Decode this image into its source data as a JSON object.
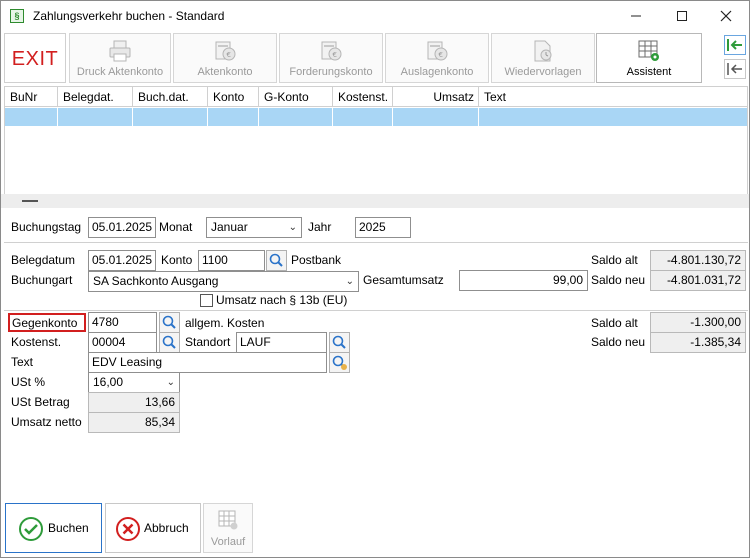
{
  "window": {
    "title": "Zahlungsverkehr buchen - Standard",
    "app_icon_glyph": "§",
    "controls": [
      "minimize",
      "maximize",
      "close"
    ]
  },
  "toolbar": {
    "exit_label": "EXIT",
    "buttons": [
      {
        "label": "Druck Aktenkonto",
        "icon": "printer-icon",
        "enabled": false
      },
      {
        "label": "Aktenkonto",
        "icon": "account-icon",
        "enabled": false
      },
      {
        "label": "Forderungskonto",
        "icon": "claim-account-icon",
        "enabled": false
      },
      {
        "label": "Auslagenkonto",
        "icon": "expense-account-icon",
        "enabled": false
      },
      {
        "label": "Wiedervorlagen",
        "icon": "resubmission-icon",
        "enabled": false
      },
      {
        "label": "Assistent",
        "icon": "grid-settings-icon",
        "enabled": true
      }
    ],
    "side_icons": [
      "arrow-left-in-icon",
      "arrow-left-out-icon"
    ]
  },
  "grid": {
    "columns": [
      "BuNr",
      "Belegdat.",
      "Buch.dat.",
      "Konto",
      "G-Konto",
      "Kostenst.",
      "Umsatz",
      "Text"
    ],
    "rows": [
      [
        "",
        "",
        "",
        "",
        "",
        "",
        "",
        ""
      ]
    ]
  },
  "header_form": {
    "buchungstag_label": "Buchungstag",
    "buchungstag_value": "05.01.2025",
    "monat_label": "Monat",
    "monat_value": "Januar",
    "jahr_label": "Jahr",
    "jahr_value": "2025"
  },
  "booking": {
    "belegdatum_label": "Belegdatum",
    "belegdatum_value": "05.01.2025",
    "konto_label": "Konto",
    "konto_value": "1100",
    "konto_name": "Postbank",
    "buchungsart_label": "Buchungart",
    "buchungsart_value": "SA Sachkonto Ausgang",
    "gesamtumsatz_label": "Gesamtumsatz",
    "gesamtumsatz_value": "99,00",
    "checkbox_label": "Umsatz nach § 13b (EU)",
    "checkbox_checked": false,
    "saldo_alt_label": "Saldo alt",
    "saldo_alt_value": "-4.801.130,72",
    "saldo_neu_label": "Saldo neu",
    "saldo_neu_value": "-4.801.031,72"
  },
  "counter": {
    "gegenkonto_label": "Gegenkonto",
    "gegenkonto_value": "4780",
    "gegenkonto_name": "allgem. Kosten",
    "kostenst_label": "Kostenst.",
    "kostenst_value": "00004",
    "standort_label": "Standort",
    "standort_value": "LAUF",
    "text_label": "Text",
    "text_value": "EDV Leasing",
    "ust_label": "USt %",
    "ust_value": "16,00",
    "ust_betrag_label": "USt Betrag",
    "ust_betrag_value": "13,66",
    "umsatz_netto_label": "Umsatz netto",
    "umsatz_netto_value": "85,34",
    "saldo_alt_label": "Saldo alt",
    "saldo_alt_value": "-1.300,00",
    "saldo_neu_label": "Saldo neu",
    "saldo_neu_value": "-1.385,34"
  },
  "footer": {
    "buchen_label": "Buchen",
    "abbruch_label": "Abbruch",
    "vorlauf_label": "Vorlauf"
  },
  "colors": {
    "accent_red": "#d21f1f",
    "selection_blue": "#a9d6f5",
    "ok_green": "#2e9b3a",
    "focus_blue": "#2a73c9"
  }
}
